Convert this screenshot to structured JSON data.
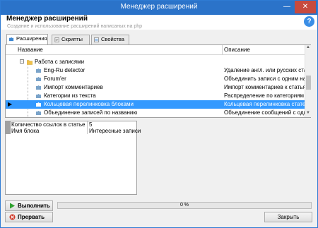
{
  "window": {
    "title": "Менеджер расширений",
    "minimize_glyph": "—",
    "close_glyph": "✕"
  },
  "header": {
    "title": "Менеджер расширений",
    "subtitle": "Создание и использование расширений написаных на php",
    "help_glyph": "?"
  },
  "tabs": [
    {
      "label": "Расширения",
      "icon": "puzzle-icon",
      "active": true
    },
    {
      "label": "Скрипты",
      "icon": "script-icon",
      "active": false
    },
    {
      "label": "Свойства",
      "icon": "properties-icon",
      "active": false
    }
  ],
  "list": {
    "columns": {
      "name": "Название",
      "description": "Описание"
    },
    "rows": [
      {
        "name": "",
        "description": "",
        "icon": "partial-row"
      },
      {
        "name": "Работа с записями",
        "description": "",
        "icon": "folder-icon",
        "expander": "-"
      },
      {
        "name": "Eng-Ru detector",
        "description": "Удаление англ. или русских ста...",
        "icon": "puzzle-icon"
      },
      {
        "name": "Forum'er",
        "description": "Объединить записи с одним на...",
        "icon": "puzzle-icon"
      },
      {
        "name": "Импорт комментариев",
        "description": "Импорт комментариев к статья...",
        "icon": "puzzle-icon"
      },
      {
        "name": "Категории из текста",
        "description": "Распределение по категориям в...",
        "icon": "puzzle-icon"
      },
      {
        "name": "Кольцевая перелинковка блоками",
        "description": "Кольцевая перелинковка статей...",
        "icon": "puzzle-icon",
        "selected": true
      },
      {
        "name": "Объединение записей по названию",
        "description": "Объединение сообщений с оди...",
        "icon": "puzzle-icon"
      }
    ],
    "selected_marker": "▶"
  },
  "properties": [
    {
      "key": "Количество ссылок в статье",
      "value": "5"
    },
    {
      "key": "Имя блока",
      "value": "Интересные записи"
    }
  ],
  "buttons": {
    "run": "Выполнить",
    "stop": "Прервать",
    "close": "Закрыть"
  },
  "progress": {
    "percent": 0,
    "label": "0 %"
  },
  "colors": {
    "titlebar": "#2b73c9",
    "selection": "#3399ff",
    "run_icon": "#2fa12f",
    "stop_icon": "#d03a2a"
  }
}
